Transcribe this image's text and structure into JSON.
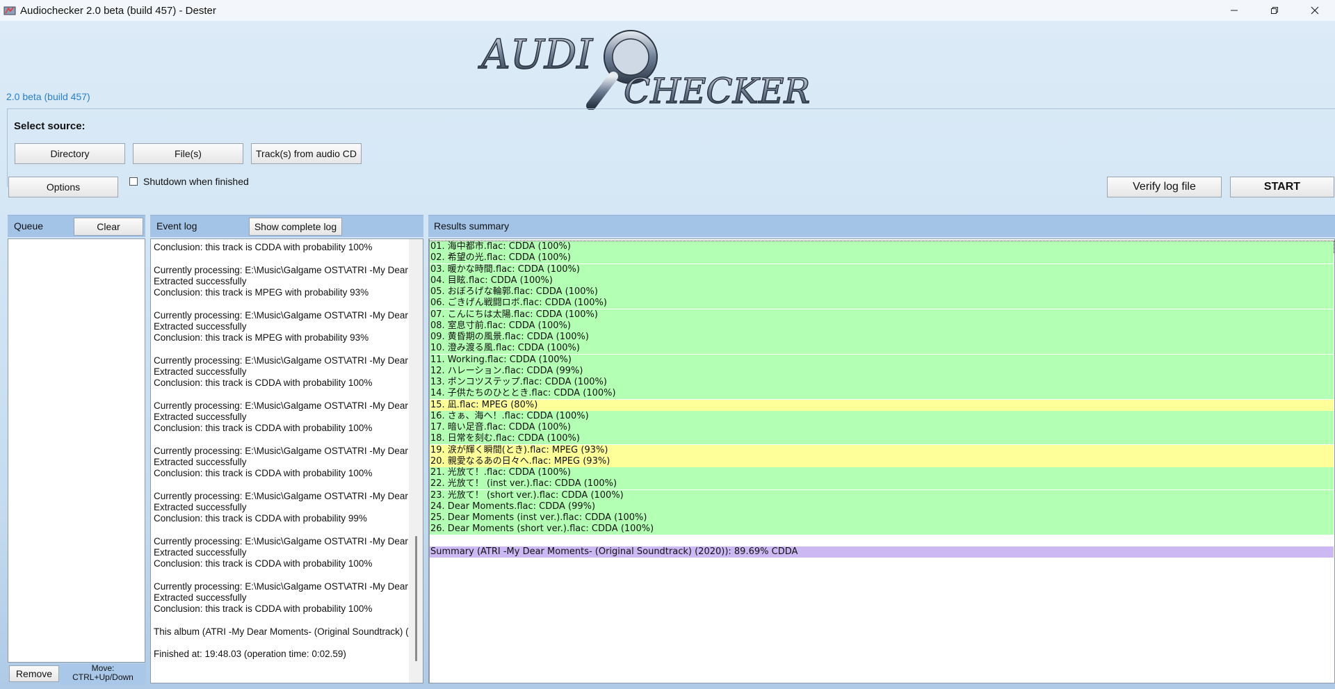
{
  "window": {
    "title": "Audiochecker 2.0 beta (build 457) - Dester"
  },
  "header": {
    "version": "2.0 beta (build 457)",
    "logo_text": "AUDIO CHECKER"
  },
  "source": {
    "label": "Select source:",
    "directory_button": "Directory",
    "files_button": "File(s)",
    "cd_button": "Track(s) from audio CD"
  },
  "toolbar": {
    "options_button": "Options",
    "shutdown_label": "Shutdown when finished",
    "shutdown_checked": false,
    "verify_button": "Verify log file",
    "start_button": "START"
  },
  "queue": {
    "title": "Queue",
    "clear_button": "Clear",
    "remove_button": "Remove",
    "move_hint_line1": "Move:",
    "move_hint_line2": "CTRL+Up/Down"
  },
  "event_log": {
    "title": "Event log",
    "show_complete_button": "Show complete log",
    "lines": [
      " Conclusion: this track is CDDA with probability 100%",
      "",
      "Currently processing: E:\\Music\\Galgame OST\\ATRI -My Dear",
      " Extracted successfully",
      " Conclusion: this track is MPEG with probability 93%",
      "",
      "Currently processing: E:\\Music\\Galgame OST\\ATRI -My Dear",
      " Extracted successfully",
      " Conclusion: this track is MPEG with probability 93%",
      "",
      "Currently processing: E:\\Music\\Galgame OST\\ATRI -My Dear",
      " Extracted successfully",
      " Conclusion: this track is CDDA with probability 100%",
      "",
      "Currently processing: E:\\Music\\Galgame OST\\ATRI -My Dear",
      " Extracted successfully",
      " Conclusion: this track is CDDA with probability 100%",
      "",
      "Currently processing: E:\\Music\\Galgame OST\\ATRI -My Dear",
      " Extracted successfully",
      " Conclusion: this track is CDDA with probability 100%",
      "",
      "Currently processing: E:\\Music\\Galgame OST\\ATRI -My Dear",
      " Extracted successfully",
      " Conclusion: this track is CDDA with probability 99%",
      "",
      "Currently processing: E:\\Music\\Galgame OST\\ATRI -My Dear",
      " Extracted successfully",
      " Conclusion: this track is CDDA with probability 100%",
      "",
      "Currently processing: E:\\Music\\Galgame OST\\ATRI -My Dear",
      " Extracted successfully",
      " Conclusion: this track is CDDA with probability 100%",
      "",
      "This album (ATRI -My Dear Moments- (Original Soundtrack) (",
      "",
      "Finished at: 19:48.03 (operation time: 0:02.59)"
    ]
  },
  "results": {
    "title": "Results summary",
    "colors": {
      "cdda": "#b3ffb3",
      "mpeg": "#ffff99",
      "summary": "#ccb8f2"
    },
    "rows": [
      {
        "text": "01. 海中都市.flac: CDDA (100%)",
        "status": "cdda"
      },
      {
        "text": "02. 希望の光.flac: CDDA (100%)",
        "status": "cdda"
      },
      {
        "text": "03. 暖かな時間.flac: CDDA (100%)",
        "status": "cdda"
      },
      {
        "text": "04. 目眩.flac: CDDA (100%)",
        "status": "cdda"
      },
      {
        "text": "05. おぼろげな輪郭.flac: CDDA (100%)",
        "status": "cdda"
      },
      {
        "text": "06. ごきげん戦闘ロボ.flac: CDDA (100%)",
        "status": "cdda"
      },
      {
        "text": "07. こんにちは太陽.flac: CDDA (100%)",
        "status": "cdda"
      },
      {
        "text": "08. 室息寸前.flac: CDDA (100%)",
        "status": "cdda"
      },
      {
        "text": "09. 黄昏期の風景.flac: CDDA (100%)",
        "status": "cdda"
      },
      {
        "text": "10. 澄み渡る風.flac: CDDA (100%)",
        "status": "cdda"
      },
      {
        "text": "11. Working.flac: CDDA (100%)",
        "status": "cdda"
      },
      {
        "text": "12. ハレーション.flac: CDDA (99%)",
        "status": "cdda"
      },
      {
        "text": "13. ポンコツステップ.flac: CDDA (100%)",
        "status": "cdda"
      },
      {
        "text": "14. 子供たちのひととき.flac: CDDA (100%)",
        "status": "cdda"
      },
      {
        "text": "15. 凪.flac: MPEG (80%)",
        "status": "mpeg"
      },
      {
        "text": "16. さぁ、海へ！.flac: CDDA (100%)",
        "status": "cdda"
      },
      {
        "text": "17. 暗い足音.flac: CDDA (100%)",
        "status": "cdda"
      },
      {
        "text": "18. 日常を刻む.flac: CDDA (100%)",
        "status": "cdda"
      },
      {
        "text": "19. 涙が輝く瞬間(とき).flac: MPEG (93%)",
        "status": "mpeg"
      },
      {
        "text": "20. 親愛なるあの日々へ.flac: MPEG (93%)",
        "status": "mpeg"
      },
      {
        "text": "21. 光放て！.flac: CDDA (100%)",
        "status": "cdda"
      },
      {
        "text": "22. 光放て！ (inst ver.).flac: CDDA (100%)",
        "status": "cdda"
      },
      {
        "text": "23. 光放て！ (short ver.).flac: CDDA (100%)",
        "status": "cdda"
      },
      {
        "text": "24. Dear Moments.flac: CDDA (99%)",
        "status": "cdda"
      },
      {
        "text": "25. Dear Moments (inst ver.).flac: CDDA (100%)",
        "status": "cdda"
      },
      {
        "text": "26. Dear Moments (short ver.).flac: CDDA (100%)",
        "status": "cdda"
      },
      {
        "text": "",
        "status": "blank"
      },
      {
        "text": "Summary (ATRI -My Dear Moments- (Original Soundtrack) (2020)): 89.69% CDDA",
        "status": "summary"
      }
    ]
  }
}
